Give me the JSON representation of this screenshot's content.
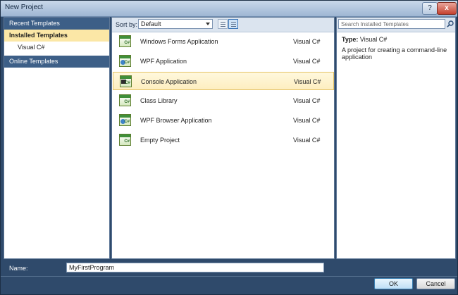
{
  "window": {
    "title": "New Project",
    "help_label": "?",
    "close_label": "x"
  },
  "sidebar": {
    "items": [
      {
        "label": "Recent Templates"
      },
      {
        "label": "Installed Templates"
      },
      {
        "label": "Visual C#"
      },
      {
        "label": "Online Templates"
      }
    ]
  },
  "toolbar": {
    "sort_label": "Sort by:",
    "sort_value": "Default"
  },
  "templates": [
    {
      "name": "Windows Forms Application",
      "language": "Visual C#",
      "icon": "windows-forms-icon",
      "icon_mark": "C#"
    },
    {
      "name": "WPF Application",
      "language": "Visual C#",
      "icon": "wpf-icon",
      "icon_mark": "C#"
    },
    {
      "name": "Console Application",
      "language": "Visual C#",
      "icon": "console-icon",
      "icon_mark": "C#"
    },
    {
      "name": "Class Library",
      "language": "Visual C#",
      "icon": "class-library-icon",
      "icon_mark": "C#"
    },
    {
      "name": "WPF Browser Application",
      "language": "Visual C#",
      "icon": "wpf-browser-icon",
      "icon_mark": "C#"
    },
    {
      "name": "Empty Project",
      "language": "Visual C#",
      "icon": "empty-project-icon",
      "icon_mark": "C#"
    }
  ],
  "selected_template_index": 2,
  "search": {
    "placeholder": "Search Installed Templates"
  },
  "details": {
    "type_label": "Type:",
    "type_value": "Visual C#",
    "description": "A project for creating a command-line application"
  },
  "footer": {
    "name_label": "Name:",
    "name_value": "MyFirstProgram",
    "ok_label": "OK",
    "cancel_label": "Cancel"
  },
  "colors": {
    "sidebar_dark": "#3d5f87",
    "sidebar_selected": "#fbe7a6",
    "accent": "#3d77b8"
  }
}
